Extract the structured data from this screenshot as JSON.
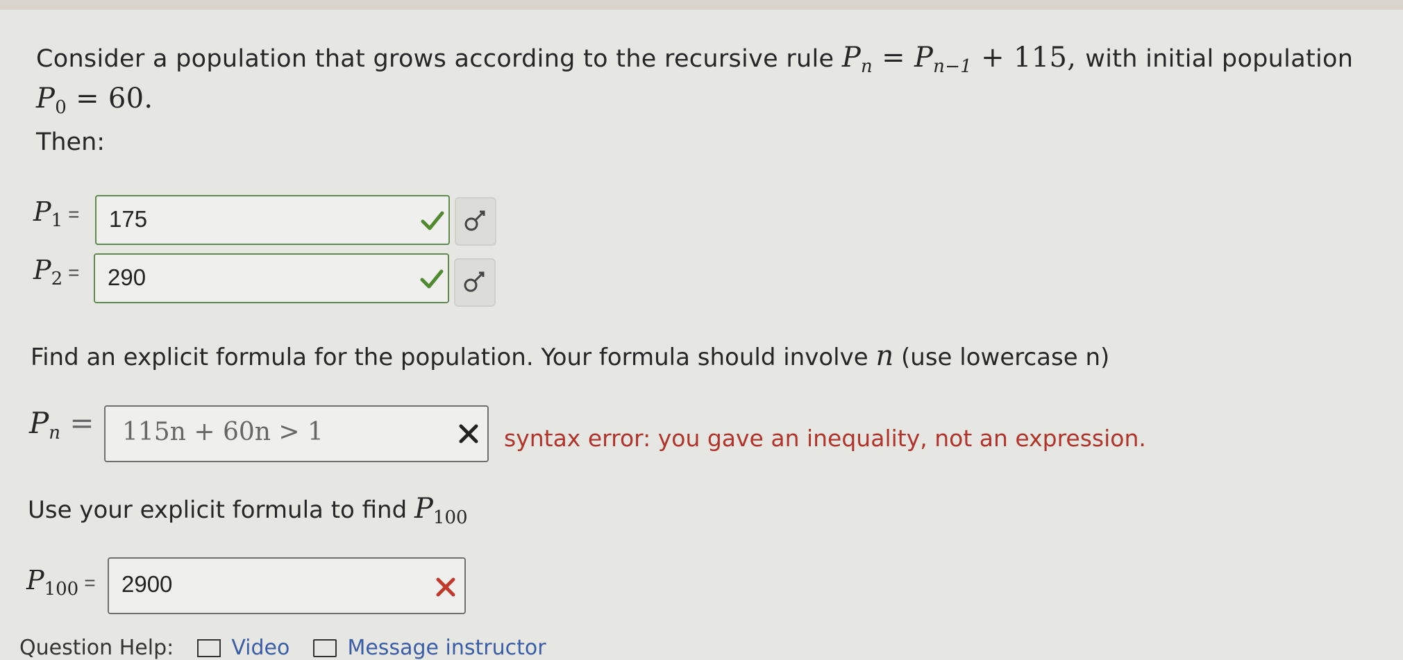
{
  "problem": {
    "intro": "Consider a population that grows according to the recursive rule",
    "rule": {
      "lhs": "P",
      "lhs_sub": "n",
      "rhs": "P",
      "rhs_sub": "n−1",
      "plus": "+ 115,"
    },
    "initial_text": "with initial population",
    "initial": {
      "sym": "P",
      "sub": "0",
      "value": "= 60."
    }
  },
  "then_label": "Then:",
  "answers": [
    {
      "sym": "P",
      "sub": "1",
      "eq": "=",
      "value": "175",
      "status": "correct"
    },
    {
      "sym": "P",
      "sub": "2",
      "eq": "=",
      "value": "290",
      "status": "correct"
    }
  ],
  "explicit": {
    "prompt_pre": "Find an explicit formula for the population. Your formula should involve",
    "var": "n",
    "prompt_post": "(use lowercase n)",
    "label_sym": "P",
    "label_sub": "n",
    "eq": "=",
    "value": "115n + 60n > 1",
    "error": "syntax error: you gave an inequality, not an expression."
  },
  "use_formula": {
    "prompt": "Use your explicit formula to find",
    "target_sym": "P",
    "target_sub": "100",
    "label_sym": "P",
    "label_sub": "100",
    "eq": "=",
    "value": "2900",
    "status": "incorrect"
  },
  "help": {
    "label": "Question Help:",
    "video": "Video",
    "message": "Message instructor"
  },
  "colors": {
    "correct": "#4f8a2f",
    "incorrect": "#c0392b",
    "error_text": "#b1332a",
    "link": "#3a5da8"
  }
}
